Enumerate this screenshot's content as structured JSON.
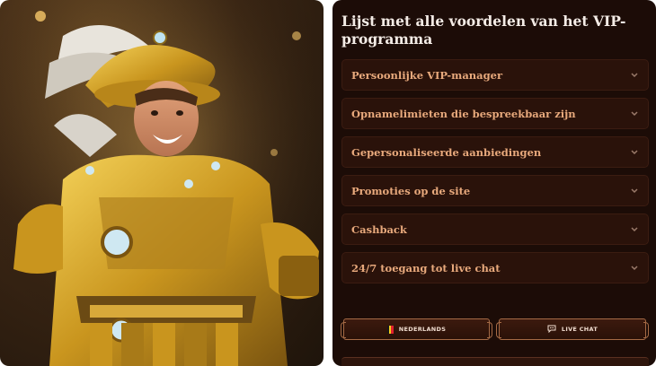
{
  "panel": {
    "title": "Lijst met alle voordelen van het VIP-programma",
    "items": [
      {
        "label": "Persoonlijke VIP-manager"
      },
      {
        "label": "Opnamelimieten die bespreekbaar zijn"
      },
      {
        "label": "Gepersonaliseerde aanbiedingen"
      },
      {
        "label": "Promoties op de site"
      },
      {
        "label": "Cashback"
      },
      {
        "label": "24/7 toegang tot live chat"
      }
    ]
  },
  "buttons": {
    "language": "NEDERLANDS",
    "live_chat": "LIVE CHAT"
  },
  "colors": {
    "panel_bg": "#1c0c07",
    "item_bg": "#2a120a",
    "item_text": "#e8a97c",
    "title_text": "#f4ece6",
    "accent_border": "#a56a45"
  },
  "icons": {
    "chevron": "chevron-down-icon",
    "flag": "belgium-flag-icon",
    "chat": "chat-bubble-icon"
  }
}
